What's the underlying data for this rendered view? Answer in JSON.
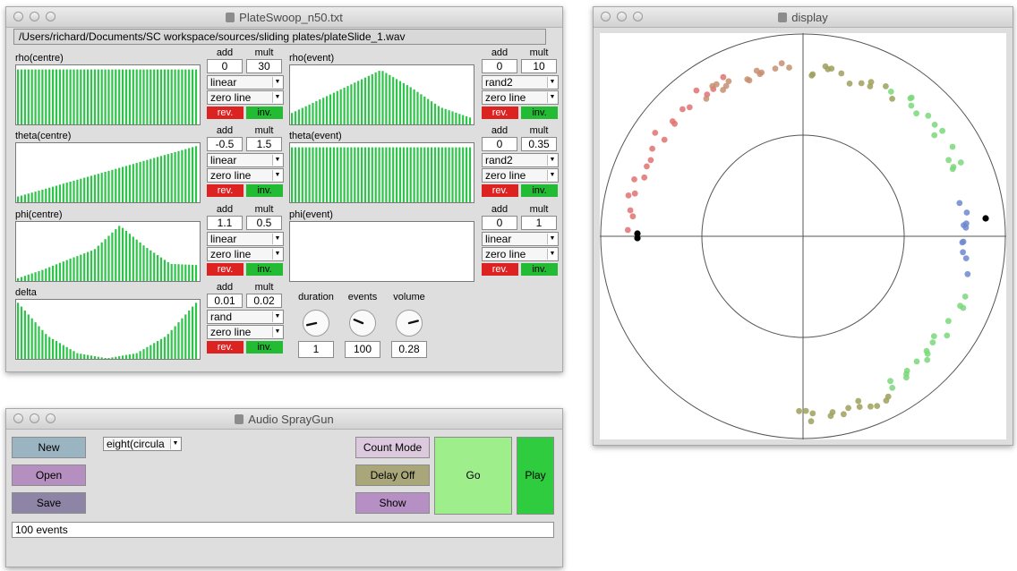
{
  "plate_window": {
    "title": "PlateSwoop_n50.txt",
    "path": "/Users/richard/Documents/SC workspace/sources/sliding plates/plateSlide_1.wav",
    "add_label": "add",
    "mult_label": "mult",
    "rev_label": "rev.",
    "inv_label": "inv.",
    "params": [
      {
        "label": "rho(centre)",
        "add": "0",
        "mult": "30",
        "curve": "linear",
        "line": "zero line",
        "values_desc": "flat",
        "values": [
          0.96
        ]
      },
      {
        "label": "rho(event)",
        "add": "0",
        "mult": "10",
        "curve": "rand2",
        "line": "zero line",
        "values": [
          0.2,
          0.45,
          0.7,
          0.95,
          0.65,
          0.3,
          0.12
        ]
      },
      {
        "label": "theta(centre)",
        "add": "-0.5",
        "mult": "1.5",
        "curve": "linear",
        "line": "zero line",
        "values": [
          0.1,
          0.98
        ]
      },
      {
        "label": "theta(event)",
        "add": "0",
        "mult": "0.35",
        "curve": "rand2",
        "line": "zero line",
        "values": [
          0.96
        ]
      },
      {
        "label": "phi(centre)",
        "add": "1.1",
        "mult": "0.5",
        "curve": "linear",
        "line": "zero line",
        "values": [
          0.05,
          0.2,
          0.38,
          0.55,
          0.97,
          0.6,
          0.3,
          0.28
        ]
      },
      {
        "label": "phi(event)",
        "add": "0",
        "mult": "1",
        "curve": "linear",
        "line": "zero line",
        "values": []
      },
      {
        "label": "delta",
        "add": "0.01",
        "mult": "0.02",
        "curve": "rand",
        "line": "zero line",
        "values": [
          0.98,
          0.4,
          0.1,
          0.01,
          0.1,
          0.4,
          0.98
        ]
      }
    ],
    "knobs": [
      {
        "label": "duration",
        "value": "1",
        "level": 0.12
      },
      {
        "label": "events",
        "value": "100",
        "level": 0.25
      },
      {
        "label": "volume",
        "value": "0.28",
        "level": 0.78
      }
    ]
  },
  "spray_window": {
    "title": "Audio SprayGun",
    "new_label": "New",
    "open_label": "Open",
    "save_label": "Save",
    "mode_select": "eight(circula",
    "count_mode_label": "Count Mode",
    "delay_off_label": "Delay Off",
    "show_label": "Show",
    "go_label": "Go",
    "play_label": "Play",
    "status_text": "100 events",
    "colors": {
      "new": "#9bb4c2",
      "open": "#b58fbf",
      "save": "#8d84a6",
      "count": "#ddc9dd",
      "delay": "#a9a67a",
      "show": "#b68fc4",
      "go": "#9eee8c",
      "play": "#2ecc3e"
    }
  },
  "display_window": {
    "title": "display",
    "colors": {
      "red": "#e27272",
      "brown": "#c58f70",
      "olive": "#9da05c",
      "green": "#7bd87b",
      "blue": "#6f88cf",
      "black": "#000000"
    }
  }
}
